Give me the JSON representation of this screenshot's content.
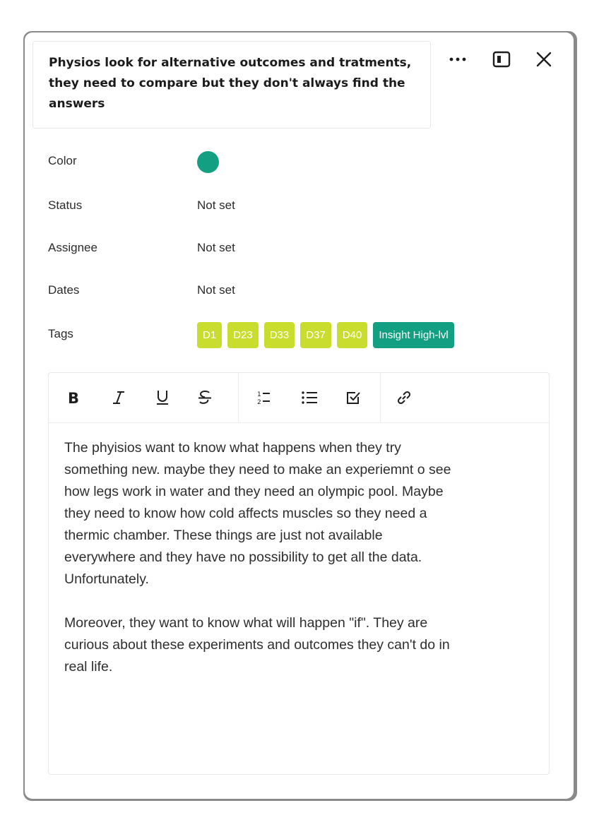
{
  "card": {
    "title": "Physios look for alternative outcomes and tratments, they need to compare but they don't always find the answers"
  },
  "header_actions": {
    "more_icon": "more-horizontal-icon",
    "panel_icon": "side-panel-icon",
    "close_icon": "close-icon"
  },
  "properties": {
    "color": {
      "label": "Color",
      "value_color": "#13a082"
    },
    "status": {
      "label": "Status",
      "value": "Not set"
    },
    "assignee": {
      "label": "Assignee",
      "value": "Not set"
    },
    "dates": {
      "label": "Dates",
      "value": "Not set"
    },
    "tags": {
      "label": "Tags",
      "items": [
        {
          "label": "D1",
          "color": "#c9dd2f"
        },
        {
          "label": "D23",
          "color": "#c9dd2f"
        },
        {
          "label": "D33",
          "color": "#c9dd2f"
        },
        {
          "label": "D37",
          "color": "#c9dd2f"
        },
        {
          "label": "D40",
          "color": "#c9dd2f"
        },
        {
          "label": "Insight High-lvl",
          "color": "#13a082"
        }
      ]
    }
  },
  "editor": {
    "toolbar": [
      {
        "name": "bold",
        "icon": "bold-icon"
      },
      {
        "name": "italic",
        "icon": "italic-icon"
      },
      {
        "name": "underline",
        "icon": "underline-icon"
      },
      {
        "name": "strikethrough",
        "icon": "strikethrough-icon"
      },
      {
        "name": "numbered-list",
        "icon": "numbered-list-icon"
      },
      {
        "name": "bullet-list",
        "icon": "bullet-list-icon"
      },
      {
        "name": "checklist",
        "icon": "checklist-icon"
      },
      {
        "name": "link",
        "icon": "link-icon"
      }
    ],
    "content": "The phyisios want to know what happens when they try\nsomething new. maybe they need to make an experiemnt o see\nhow legs work in water and they need an olympic pool. Maybe\nthey need to know how cold affects muscles so they need a\nthermic chamber. These things are just not available\neverywhere and they have no possibility to get all the data.\nUnfortunately.\n\nMoreover, they want to know what will happen \"if\". They are\ncurious about these experiments and outcomes they can't do in\nreal life."
  }
}
